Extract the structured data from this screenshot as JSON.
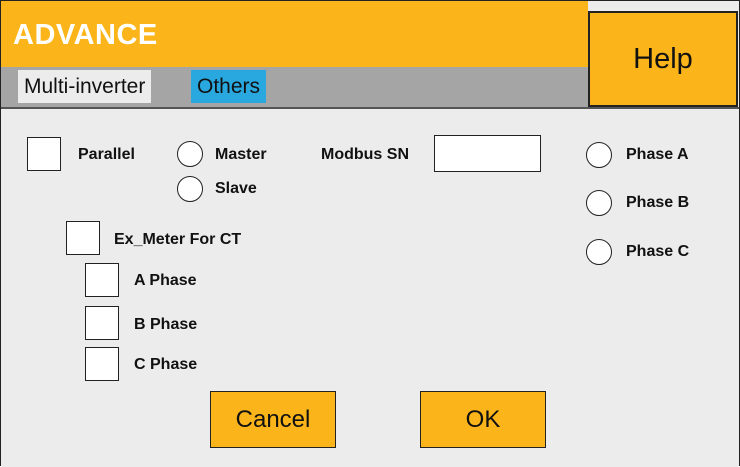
{
  "window": {
    "title": "ADVANCE",
    "help_label": "Help"
  },
  "tabs": [
    {
      "label": "Multi-inverter",
      "active": true
    },
    {
      "label": "Others",
      "active": false
    }
  ],
  "options": {
    "parallel_label": "Parallel",
    "master_label": "Master",
    "slave_label": "Slave",
    "modbus_sn_label": "Modbus SN",
    "modbus_sn_value": "",
    "ex_meter_label": "Ex_Meter For CT",
    "a_phase_label": "A Phase",
    "b_phase_label": "B Phase",
    "c_phase_label": "C Phase",
    "phase_a_label": "Phase A",
    "phase_b_label": "Phase B",
    "phase_c_label": "Phase C"
  },
  "buttons": {
    "cancel_label": "Cancel",
    "ok_label": "OK"
  },
  "colors": {
    "accent": "#fbb51a",
    "tab_highlight": "#29a8e0",
    "tab_strip": "#a5a5a5",
    "background": "#ececec"
  }
}
